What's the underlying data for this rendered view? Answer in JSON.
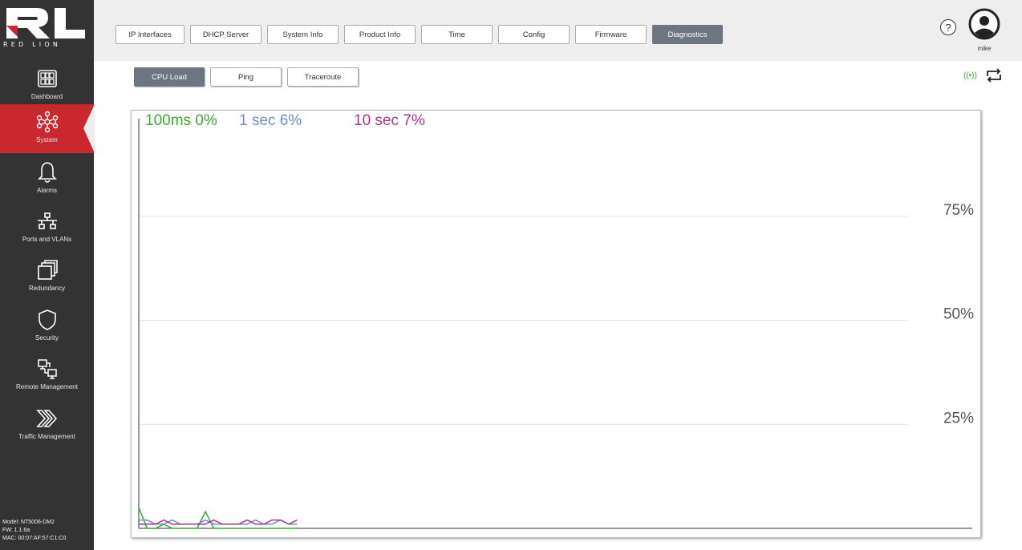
{
  "brand": {
    "logo_text": "RL",
    "brand_text": "RED LION"
  },
  "sidebar": {
    "items": [
      {
        "label": "Dashboard",
        "icon": "dashboard-icon"
      },
      {
        "label": "System",
        "icon": "network-icon",
        "active": true
      },
      {
        "label": "Alarms",
        "icon": "bell-icon"
      },
      {
        "label": "Ports and VLANs",
        "icon": "ports-icon"
      },
      {
        "label": "Redundancy",
        "icon": "copies-icon"
      },
      {
        "label": "Security",
        "icon": "shield-icon"
      },
      {
        "label": "Remote Management",
        "icon": "remote-icon"
      },
      {
        "label": "Traffic Management",
        "icon": "double-chevron-icon"
      }
    ],
    "model": "Model: NT5006-DM2",
    "fw": "FW: 1.1.6a",
    "mac": "MAC: 00:07:AF:57:C1:C0"
  },
  "tabs": [
    {
      "label": "IP Interfaces"
    },
    {
      "label": "DHCP Server"
    },
    {
      "label": "System Info"
    },
    {
      "label": "Product Info"
    },
    {
      "label": "Time"
    },
    {
      "label": "Config"
    },
    {
      "label": "Firmware"
    },
    {
      "label": "Diagnostics",
      "active": true
    }
  ],
  "subtabs": [
    {
      "label": "CPU Load",
      "active": true
    },
    {
      "label": "Ping"
    },
    {
      "label": "Traceroute"
    }
  ],
  "header": {
    "help_label": "?",
    "username": "mike"
  },
  "status": {
    "wifi_label": "((•))"
  },
  "readouts": {
    "r100": "100ms 0%",
    "r1s": "1 sec 6%",
    "r10s": "10 sec 7%"
  },
  "colors": {
    "accent": "#c8282e",
    "series_100ms": "#3aaa35",
    "series_1s": "#6b8fc9",
    "series_10s": "#a8358c"
  },
  "chart_data": {
    "type": "line",
    "ylim": [
      0,
      100
    ],
    "ytick_labels": [
      "75%",
      "50%",
      "25%"
    ],
    "yticks": [
      75,
      50,
      25
    ],
    "x_capacity": 100,
    "series": [
      {
        "name": "100ms",
        "color": "#3aaa35",
        "values": [
          5,
          0,
          0,
          1,
          0,
          0,
          0,
          0,
          4,
          0,
          0,
          0,
          0,
          0,
          0,
          0,
          0,
          0,
          0,
          0
        ]
      },
      {
        "name": "1 sec",
        "color": "#6b8fc9",
        "values": [
          2,
          2,
          1,
          1,
          2,
          1,
          1,
          1,
          2,
          1,
          1,
          1,
          1,
          1,
          2,
          1,
          1,
          2,
          1,
          1
        ]
      },
      {
        "name": "10 sec",
        "color": "#a8358c",
        "values": [
          1,
          1,
          1,
          2,
          1,
          1,
          1,
          1,
          1,
          2,
          1,
          1,
          1,
          2,
          1,
          1,
          2,
          2,
          1,
          2
        ]
      }
    ]
  }
}
